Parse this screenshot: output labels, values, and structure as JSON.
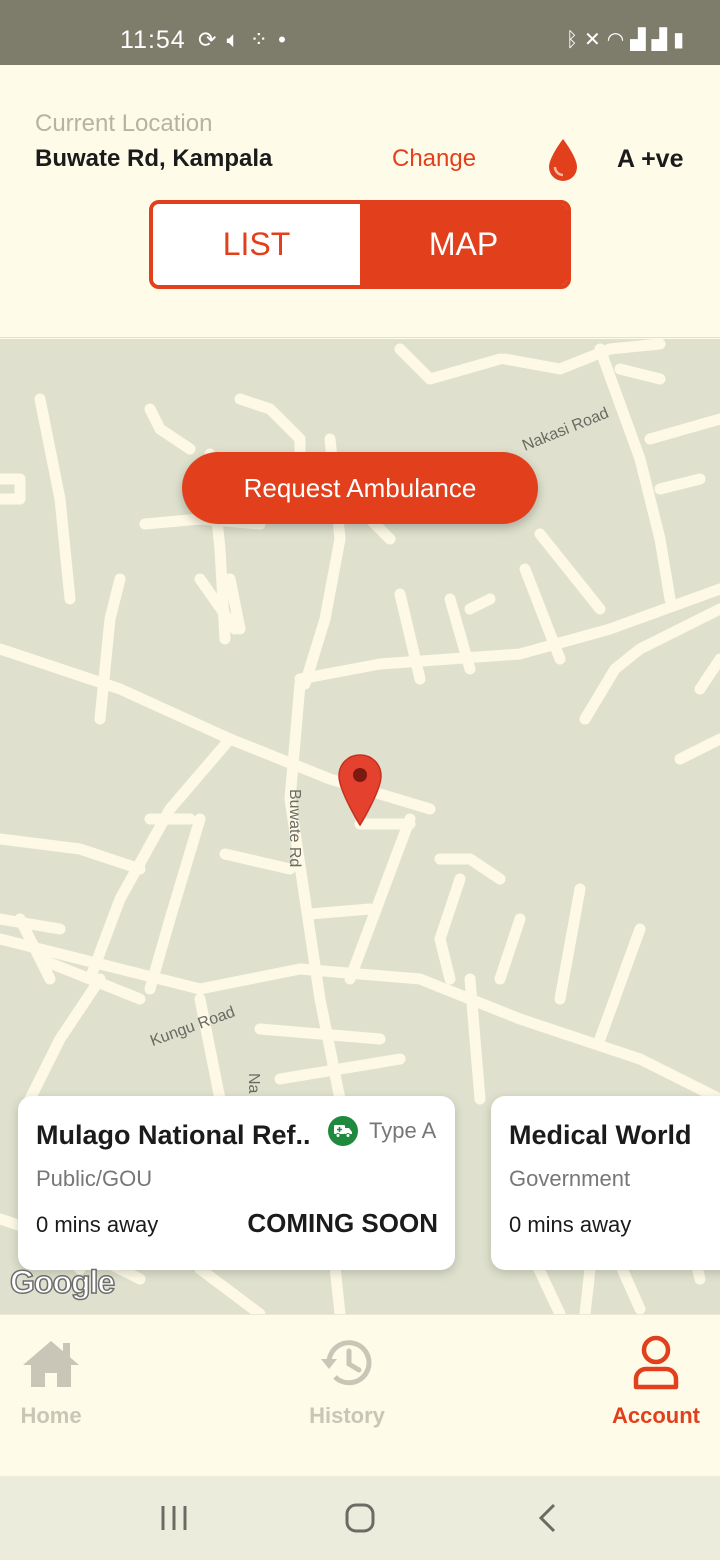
{
  "status_bar": {
    "time": "11:54",
    "left_icons": [
      "sync-icon",
      "volume-icon",
      "apps-icon",
      "dot-icon"
    ],
    "right_icons": [
      "bluetooth-icon",
      "mute-icon",
      "wifi-icon",
      "signal-icon",
      "signal-icon",
      "battery-icon"
    ]
  },
  "header": {
    "location_label": "Current Location",
    "location_value": "Buwate Rd,  Kampala",
    "change_label": "Change",
    "blood_type": "A +ve",
    "toggle": {
      "list_label": "LIST",
      "map_label": "MAP",
      "active": "MAP"
    }
  },
  "map": {
    "request_button": "Request Ambulance",
    "road_labels": {
      "nakasi": "Nakasi Road",
      "buwate": "Buwate Rd",
      "kungu": "Kungu Road",
      "na": "Na"
    },
    "attribution": "Google",
    "cards": [
      {
        "title": "Mulago National Ref..",
        "ambulance_type": "Type A",
        "ownership": "Public/GOU",
        "distance": "0 mins away",
        "status": "COMING SOON"
      },
      {
        "title": "Medical World",
        "ownership": "Government",
        "distance": "0 mins away"
      }
    ]
  },
  "bottom_nav": {
    "items": [
      {
        "label": "Home",
        "icon": "home-icon",
        "active": false
      },
      {
        "label": "History",
        "icon": "history-icon",
        "active": false
      },
      {
        "label": "Account",
        "icon": "account-icon",
        "active": true
      }
    ]
  },
  "system_nav": [
    "recent-apps-icon",
    "home-circle-icon",
    "back-icon"
  ],
  "colors": {
    "accent": "#e2401c",
    "background": "#fffbe9",
    "map_land": "#dfe1ce",
    "map_road": "#fdf9e6",
    "ambulance_badge": "#1f8a3d"
  }
}
